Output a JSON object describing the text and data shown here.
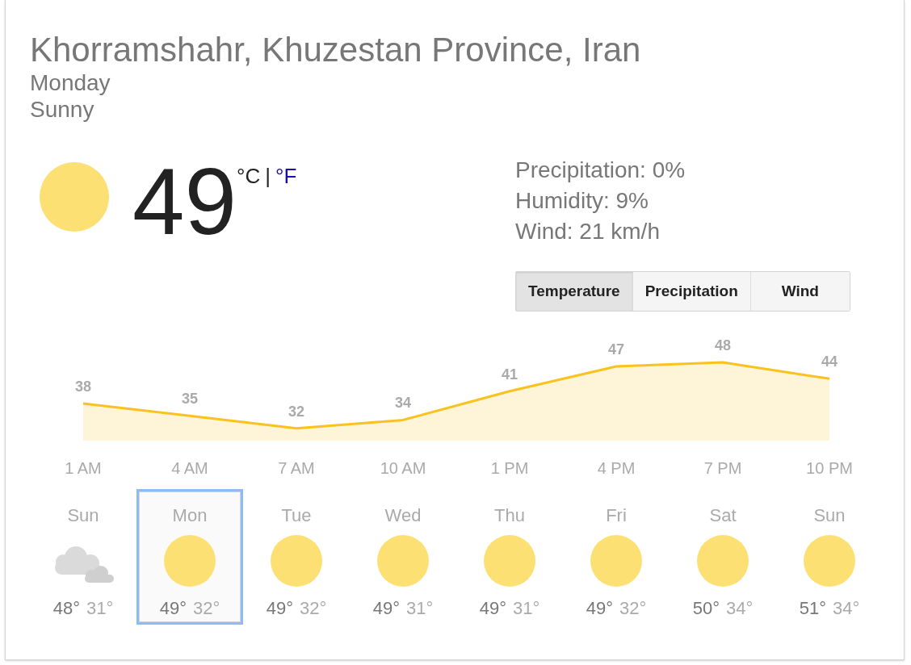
{
  "location": "Khorramshahr, Khuzestan Province, Iran",
  "day": "Monday",
  "condition": "Sunny",
  "current": {
    "kind": "sunny",
    "temperature": "49",
    "units": [
      {
        "label": "°C",
        "selected": true
      },
      {
        "label": "°F",
        "selected": false
      }
    ],
    "unit_separator": "|"
  },
  "details": [
    "Precipitation: 0%",
    "Humidity: 9%",
    "Wind: 21 km/h"
  ],
  "tabs": [
    {
      "label": "Temperature",
      "selected": true
    },
    {
      "label": "Precipitation",
      "selected": false
    },
    {
      "label": "Wind",
      "selected": false
    }
  ],
  "chart": {
    "chart_data": {
      "type": "area",
      "categories": [
        "1 AM",
        "4 AM",
        "7 AM",
        "10 AM",
        "1 PM",
        "4 PM",
        "7 PM",
        "10 PM"
      ],
      "series": [
        {
          "color": "#fbc21e",
          "values": [
            38,
            35,
            32,
            34,
            41,
            47,
            48,
            44
          ]
        }
      ],
      "data_labels": true
    }
  },
  "days": [
    {
      "name": "Sun",
      "kind": "cloudy",
      "high": "48°",
      "low": "31°",
      "selected": false
    },
    {
      "name": "Mon",
      "kind": "sunny",
      "high": "49°",
      "low": "32°",
      "selected": true
    },
    {
      "name": "Tue",
      "kind": "sunny",
      "high": "49°",
      "low": "32°",
      "selected": false
    },
    {
      "name": "Wed",
      "kind": "sunny",
      "high": "49°",
      "low": "31°",
      "selected": false
    },
    {
      "name": "Thu",
      "kind": "sunny",
      "high": "49°",
      "low": "31°",
      "selected": false
    },
    {
      "name": "Fri",
      "kind": "sunny",
      "high": "49°",
      "low": "32°",
      "selected": false
    },
    {
      "name": "Sat",
      "kind": "sunny",
      "high": "50°",
      "low": "34°",
      "selected": false
    },
    {
      "name": "Sun",
      "kind": "sunny",
      "high": "51°",
      "low": "34°",
      "selected": false
    }
  ]
}
